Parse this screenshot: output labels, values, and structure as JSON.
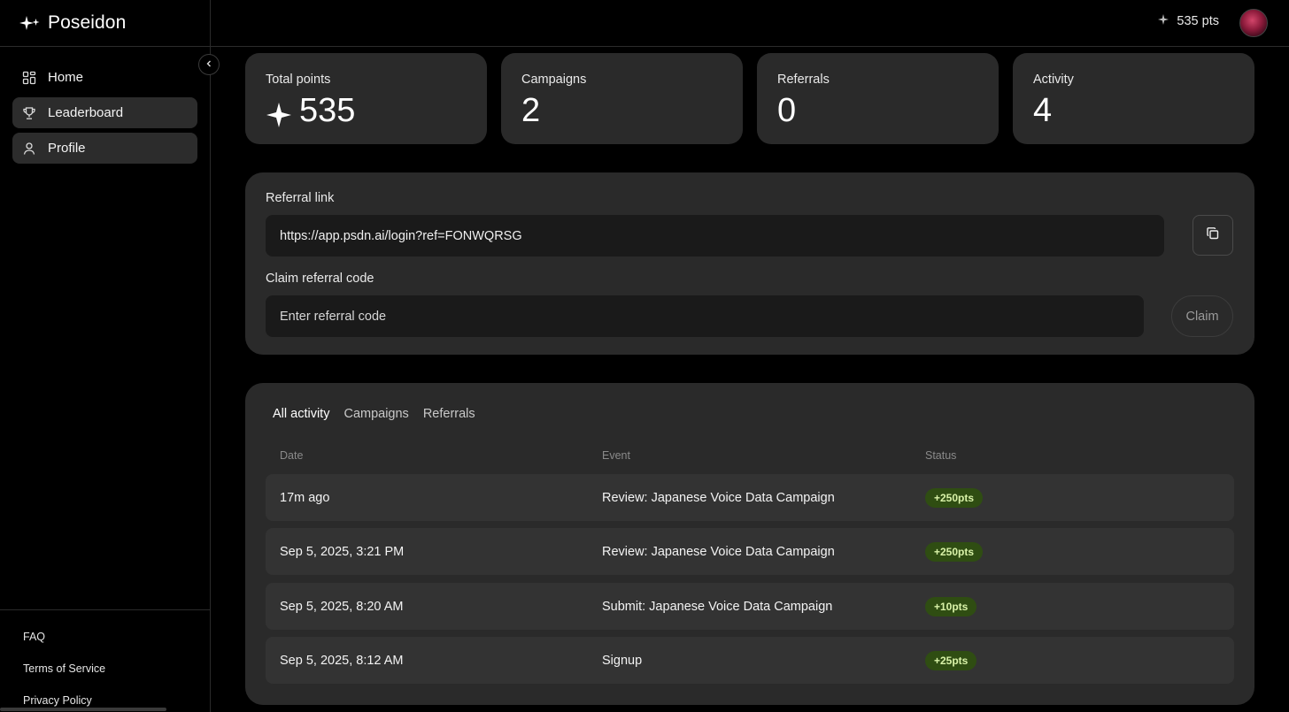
{
  "brand": {
    "name": "Poseidon",
    "icon": "sparkles-icon"
  },
  "sidebar": {
    "items": [
      {
        "label": "Home",
        "icon": "grid-icon",
        "active": false
      },
      {
        "label": "Leaderboard",
        "icon": "trophy-icon",
        "active": true
      },
      {
        "label": "Profile",
        "icon": "user-icon",
        "active": true
      }
    ],
    "footer": [
      "FAQ",
      "Terms of Service",
      "Privacy Policy"
    ]
  },
  "header": {
    "points": "535 pts"
  },
  "stats": [
    {
      "label": "Total points",
      "value": "535",
      "icon": "sparkle-icon"
    },
    {
      "label": "Campaigns",
      "value": "2"
    },
    {
      "label": "Referrals",
      "value": "0"
    },
    {
      "label": "Activity",
      "value": "4"
    }
  ],
  "referral": {
    "link_label": "Referral link",
    "link_value": "https://app.psdn.ai/login?ref=FONWQRSG",
    "claim_label": "Claim referral code",
    "claim_placeholder": "Enter referral code",
    "claim_button": "Claim"
  },
  "activity": {
    "tabs": [
      "All activity",
      "Campaigns",
      "Referrals"
    ],
    "active_tab": "All activity",
    "columns": [
      "Date",
      "Event",
      "Status"
    ],
    "rows": [
      {
        "date": "17m ago",
        "event": "Review: Japanese Voice Data Campaign",
        "status": "+250pts"
      },
      {
        "date": "Sep 5, 2025, 3:21 PM",
        "event": "Review: Japanese Voice Data Campaign",
        "status": "+250pts"
      },
      {
        "date": "Sep 5, 2025, 8:20 AM",
        "event": "Submit: Japanese Voice Data Campaign",
        "status": "+10pts"
      },
      {
        "date": "Sep 5, 2025, 8:12 AM",
        "event": "Signup",
        "status": "+25pts"
      }
    ]
  },
  "colors": {
    "background": "#000000",
    "card": "#2a2a2a",
    "row": "#333333",
    "badge_bg": "#2f4d12",
    "badge_text": "#d9f2a8"
  }
}
